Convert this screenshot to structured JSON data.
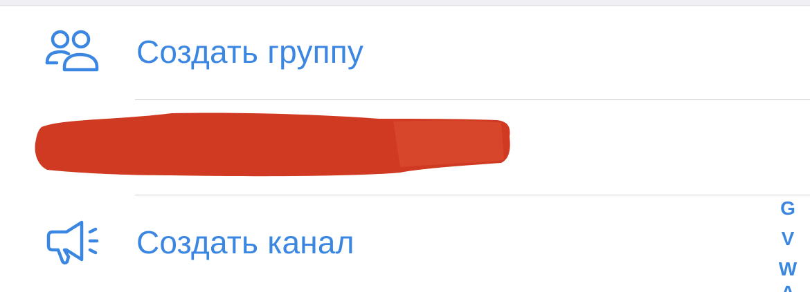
{
  "menu": {
    "items": [
      {
        "label": "Создать группу",
        "icon": "people-group-icon"
      },
      {
        "label": "",
        "icon": "",
        "redacted": true
      },
      {
        "label": "Создать канал",
        "icon": "megaphone-icon"
      }
    ]
  },
  "index_bar": {
    "letters": [
      "G",
      "V",
      "W",
      "A"
    ]
  },
  "colors": {
    "accent": "#3a86e0",
    "redaction": "#d03a22",
    "separator": "#cfcfd4"
  }
}
